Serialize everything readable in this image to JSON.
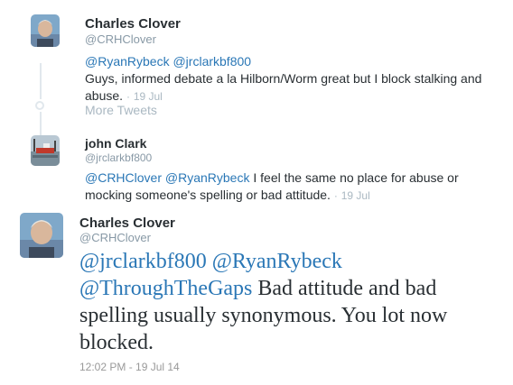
{
  "tweets": [
    {
      "name": "Charles Clover",
      "handle": "@CRHClover",
      "mentions": [
        "@RyanRybeck",
        "@jrclarkbf800"
      ],
      "text": "Guys, informed debate a la Hilborn/Worm great but I block stalking and abuse.",
      "time": "19 Jul",
      "avatar_icon": "charles-clover-avatar"
    },
    {
      "name": "john Clark",
      "handle": "@jrclarkbf800",
      "mentions": [
        "@CRHClover",
        "@RyanRybeck"
      ],
      "text": "I feel the same no place for abuse or mocking someone's spelling or bad attitude.",
      "time": "19 Jul",
      "avatar_icon": "fishing-boat-avatar"
    }
  ],
  "more_tweets_label": "More Tweets",
  "main_tweet": {
    "name": "Charles Clover",
    "handle": "@CRHClover",
    "mentions": [
      "@jrclarkbf800",
      "@RyanRybeck",
      "@ThroughTheGaps"
    ],
    "text": "Bad attitude and bad spelling usually synonymous. You lot now blocked.",
    "timestamp": "12:02 PM - 19 Jul 14"
  },
  "colors": {
    "link": "#2a77b6",
    "muted": "#8899a6",
    "timestamp": "#aab8c2"
  }
}
